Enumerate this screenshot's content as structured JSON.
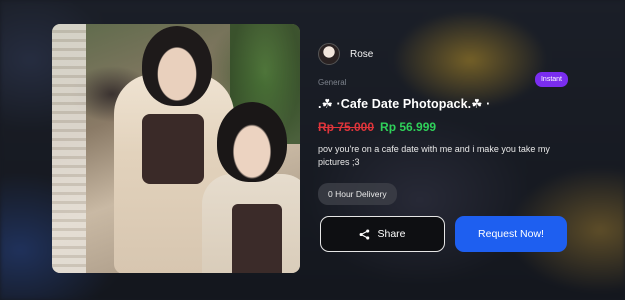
{
  "seller": {
    "name": "Rose"
  },
  "listing": {
    "category": "General",
    "badge": "Instant",
    "title": ".☘ ·Cafe Date Photopack.☘ ·",
    "old_price": "Rp 75.000",
    "new_price": "Rp 56.999",
    "description": "pov you're on a cafe date with me and i make you take my pictures ;3",
    "delivery": "0 Hour Delivery"
  },
  "actions": {
    "share_label": "Share",
    "request_label": "Request Now!"
  },
  "colors": {
    "badge": "#7a2df0",
    "old_price": "#e0353b",
    "new_price": "#2fd15a",
    "primary_button": "#1e5ff0"
  },
  "icons": {
    "share": "share-icon"
  }
}
